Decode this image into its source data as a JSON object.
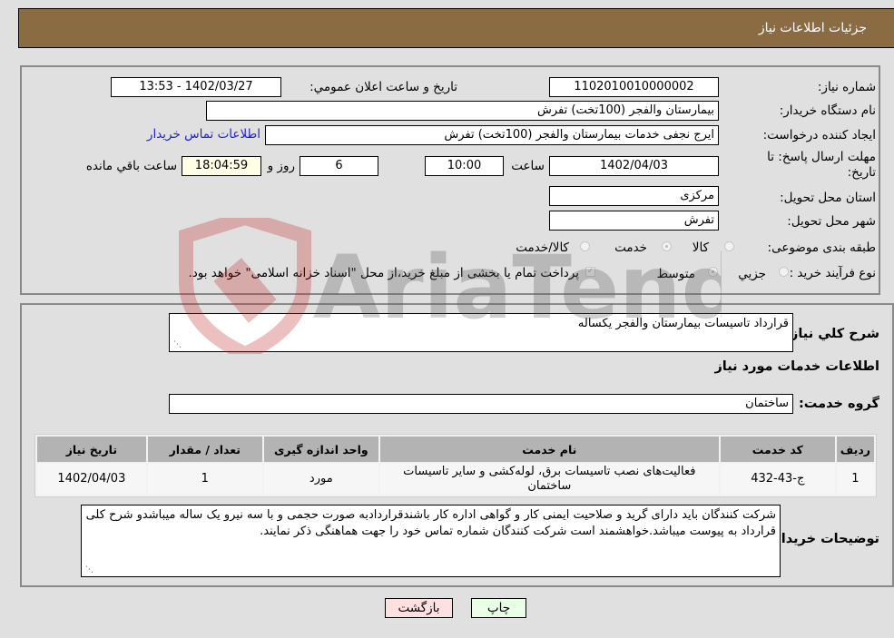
{
  "header": {
    "title": "جزئیات اطلاعات نیاز"
  },
  "info": {
    "need_number_label": "شماره نیاز:",
    "need_number": "1102010010000002",
    "announce_label": "تاریخ و ساعت اعلان عمومي:",
    "announce_value": "1402/03/27 - 13:53",
    "buyer_org_label": "نام دستگاه خریدار:",
    "buyer_org": "بیمارستان والفجر (100تخت) تفرش",
    "creator_label": "ایجاد کننده درخواست:",
    "creator": "ایرج نجفی خدمات بیمارستان والفجر (100تخت) تفرش",
    "contact_link": "اطلاعات تماس خریدار",
    "deadline_label_line1": "مهلت ارسال پاسخ: تا",
    "deadline_label_line2": "تاریخ:",
    "deadline_date": "1402/04/03",
    "time_label": "ساعت",
    "deadline_time": "10:00",
    "days": "6",
    "days_label": "روز و",
    "remaining_time": "18:04:59",
    "remaining_label": "ساعت باقي مانده",
    "province_label": "استان محل تحویل:",
    "province": "مرکزی",
    "city_label": "شهر محل تحویل:",
    "city": "تفرش",
    "category_label": "طبقه بندی موضوعی:",
    "category_options": [
      {
        "label": "کالا",
        "selected": false
      },
      {
        "label": "خدمت",
        "selected": true
      },
      {
        "label": "کالا/خدمت",
        "selected": false
      }
    ],
    "process_label": "نوع فرآیند خرید :",
    "process_options": [
      {
        "label": "جزيي",
        "selected": false
      },
      {
        "label": "متوسط",
        "selected": true
      }
    ],
    "treasury_note": "پرداخت تمام یا بخشی از مبلغ خرید،از محل \"اسناد خزانه اسلامی\" خواهد بود.",
    "treasury_checked": true
  },
  "details": {
    "summary_label": "شرح کلي نياز:",
    "summary": "قرارداد تاسیسات بیمارستان والفجر یکساله",
    "services_heading": "اطلاعات خدمات مورد نیاز",
    "service_group_label": "گروه خدمت:",
    "service_group": "ساختمان",
    "table": {
      "headers": [
        "ردیف",
        "کد خدمت",
        "نام خدمت",
        "واحد اندازه گیری",
        "تعداد / مقدار",
        "تاریخ نیاز"
      ],
      "rows": [
        [
          "1",
          "ج-43-432",
          "فعالیت‌های نصب تاسیسات برق، لوله‌کشی و سایر تاسیسات ساختمان",
          "مورد",
          "1",
          "1402/04/03"
        ]
      ]
    },
    "buyer_notes_label": "توضیحات خریدار:",
    "buyer_notes": "شرکت کنندگان باید دارای گرید و صلاحیت ایمنی کار و گواهی اداره کار باشندقراردادبه صورت حجمی و با سه نیرو  یک ساله میباشدو شرح کلی قرارداد به پیوست میباشد.خواهشمند است شرکت کنندگان شماره تماس خود را جهت هماهنگی ذکر نمایند."
  },
  "buttons": {
    "print": "چاپ",
    "back": "بازگشت"
  },
  "watermark": {
    "text": "AriaTender.neT"
  }
}
